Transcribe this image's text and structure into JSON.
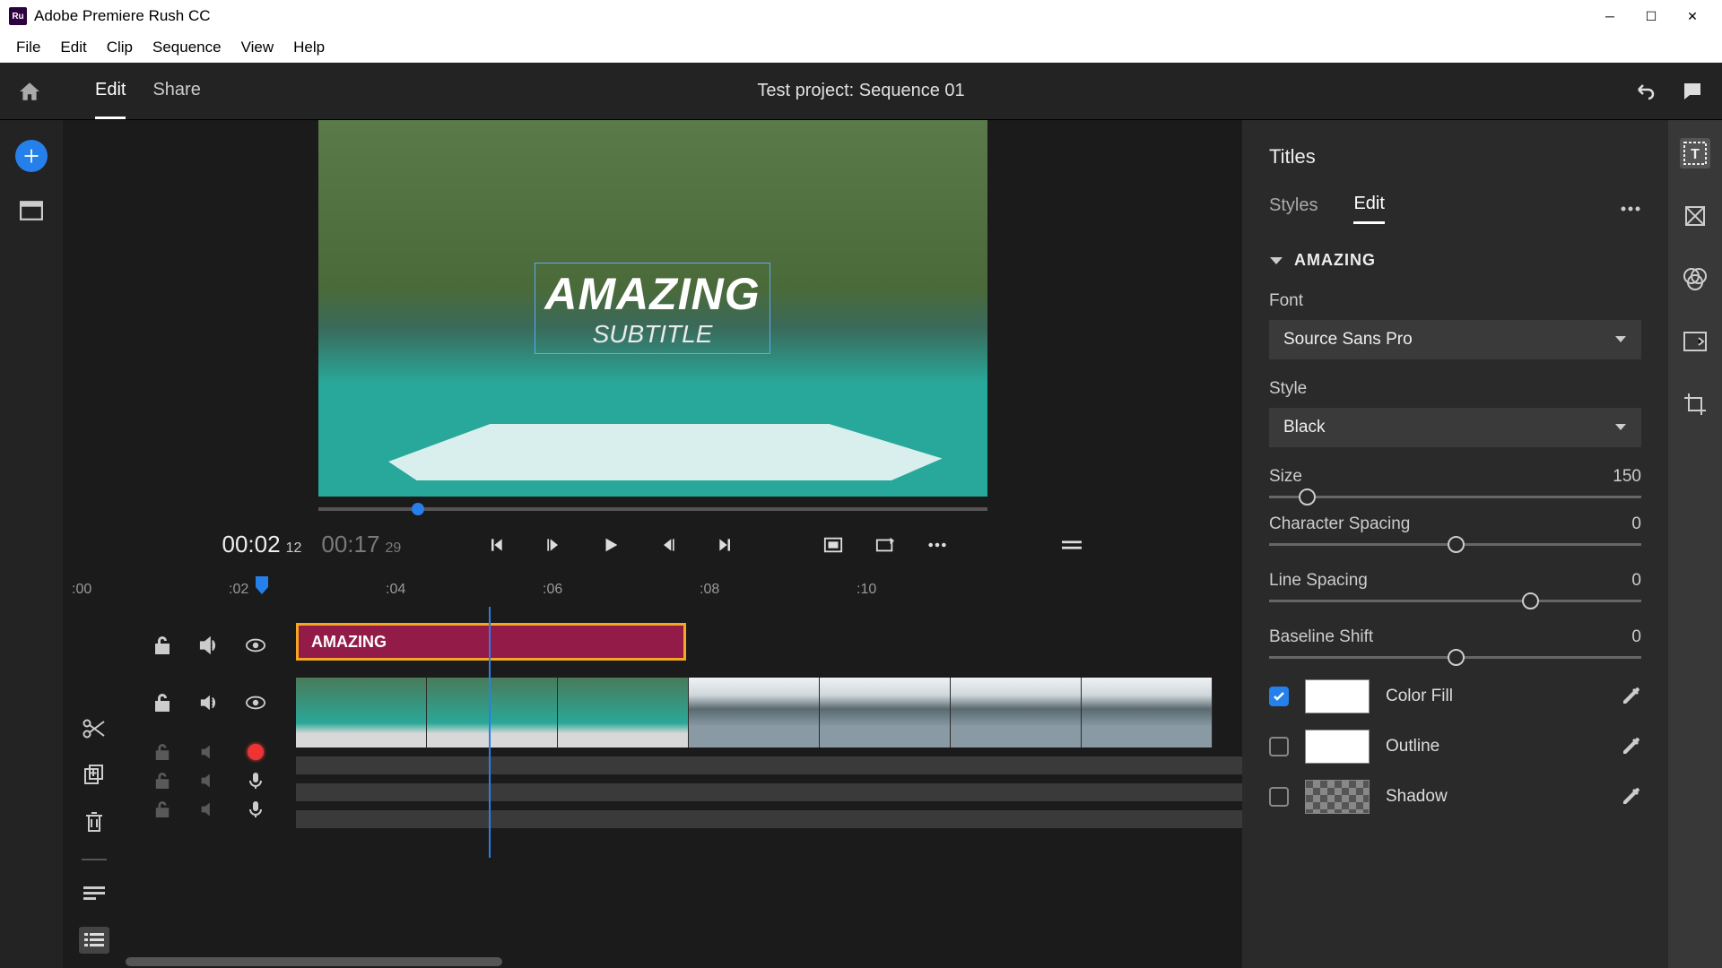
{
  "app": {
    "title": "Adobe Premiere Rush CC",
    "logo_text": "Ru"
  },
  "menu": [
    "File",
    "Edit",
    "Clip",
    "Sequence",
    "View",
    "Help"
  ],
  "header": {
    "tab_edit": "Edit",
    "tab_share": "Share",
    "project_title": "Test project: Sequence 01"
  },
  "preview": {
    "title": "AMAZING",
    "subtitle": "SUBTITLE"
  },
  "transport": {
    "current_time": "00:02",
    "current_frame": "12",
    "duration": "00:17",
    "total_frame": "29"
  },
  "ruler": {
    "t0": ":00",
    "t1": ":02",
    "t2": ":04",
    "t3": ":06",
    "t4": ":08",
    "t5": ":10"
  },
  "timeline": {
    "title_clip_label": "AMAZING"
  },
  "right_panel": {
    "title": "Titles",
    "tab_styles": "Styles",
    "tab_edit": "Edit",
    "section": "AMAZING",
    "font_label": "Font",
    "font_value": "Source Sans Pro",
    "style_label": "Style",
    "style_value": "Black",
    "size_label": "Size",
    "size_value": "150",
    "char_spacing_label": "Character Spacing",
    "char_spacing_value": "0",
    "line_spacing_label": "Line Spacing",
    "line_spacing_value": "0",
    "baseline_label": "Baseline Shift",
    "baseline_value": "0",
    "color_fill": "Color Fill",
    "outline": "Outline",
    "shadow": "Shadow"
  }
}
